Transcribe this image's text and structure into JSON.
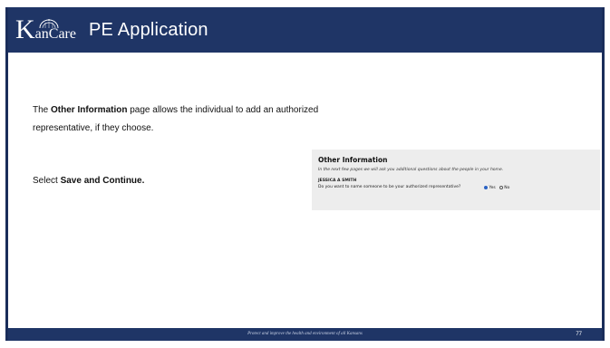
{
  "header": {
    "logo_k": "K",
    "logo_rest": "anCare",
    "title": "PE Application"
  },
  "description": {
    "text_before": "The ",
    "bold": "Other Information",
    "text_after": " page allows the individual to add an authorized representative, if they choose."
  },
  "instruction": {
    "text_before": "Select ",
    "bold": "Save and Continue."
  },
  "form_panel": {
    "title": "Other Information",
    "intro": "In the next few pages we will ask you additional questions about the people in your home.",
    "person_name": "JESSICA A SMITH",
    "question": "Do you want to name someone to be your authorized representative?",
    "options": [
      {
        "label": "Yes",
        "selected": true
      },
      {
        "label": "No",
        "selected": false
      }
    ]
  },
  "footer": {
    "tagline": "Protect and improve the health and environment of all Kansans",
    "page_number": "77"
  },
  "colors": {
    "header_bg": "#1f3566",
    "panel_bg": "#ededed",
    "radio_selected": "#2b63c4"
  }
}
